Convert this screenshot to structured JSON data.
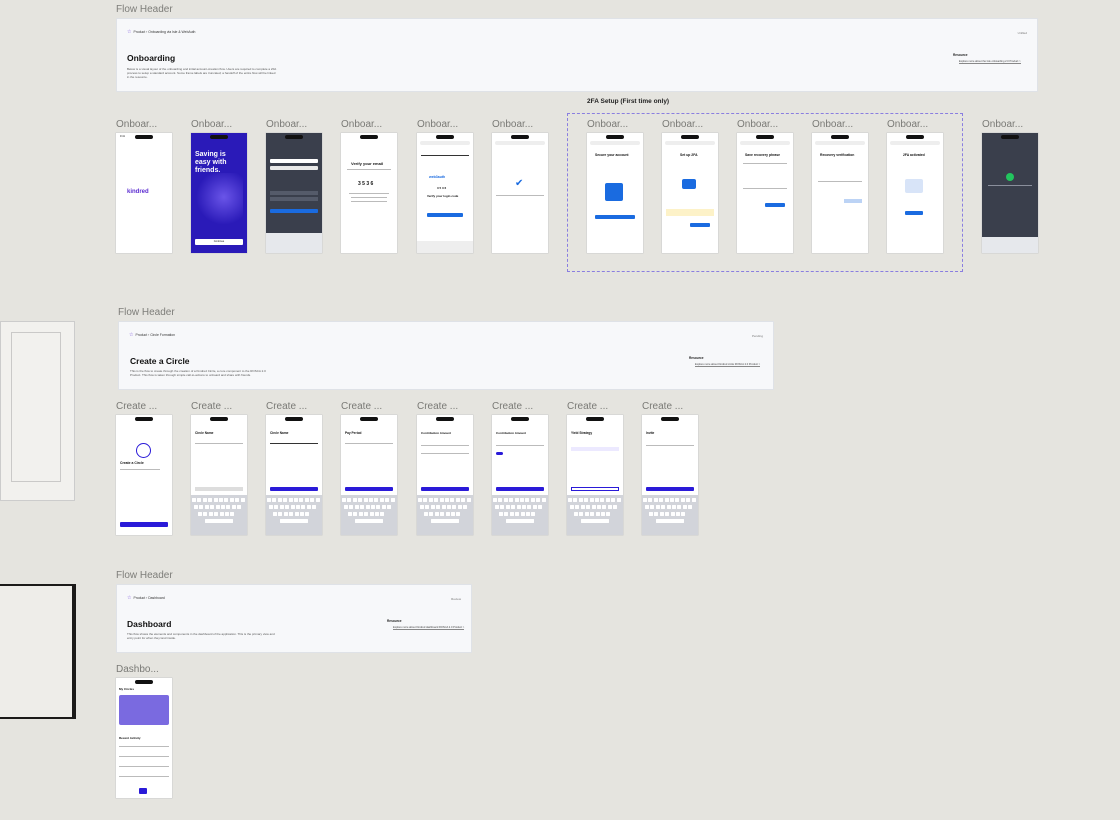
{
  "sections": [
    {
      "id": "onboarding",
      "label": "Flow Header",
      "breadcrumb_root": "Product",
      "breadcrumb_leaf": "Onboarding via Isle & WebAuth",
      "status": "Unfiled",
      "title": "Onboarding",
      "description": "Below is a visual layout of the onboarding and initial account-creation flow. Users are required to complete a 2FA process to setup a standard account. Some frame labels are truncated; a handoff of the entire flow will be linked in the resource.",
      "resource_label": "Resource",
      "resource_value": "Explore more about the Isle onboarding 2.0 Product >",
      "group_title": "2FA Setup (First time only)",
      "frames": [
        "Onboar...",
        "Onboar...",
        "Onboar...",
        "Onboar...",
        "Onboar...",
        "Onboar...",
        "Onboar...",
        "Onboar...",
        "Onboar...",
        "Onboar...",
        "Onboar...",
        "Onboar..."
      ]
    },
    {
      "id": "circle",
      "label": "Flow Header",
      "breadcrumb_root": "Product",
      "breadcrumb_leaf": "Circle Formation",
      "status": "Pending",
      "title": "Create a Circle",
      "description": "This is the flow to create through the creation of a Kindred Circle, a core component to the ROSCA 2.0 Product. This flow is taken through simple call-to-actions to onboard and share with friends.",
      "resource_label": "Resource",
      "resource_value": "Explore more about Kindred circle ROSCA 2.0 Product >",
      "frames": [
        "Create ...",
        "Create ...",
        "Create ...",
        "Create ...",
        "Create ...",
        "Create ...",
        "Create ...",
        "Create ..."
      ]
    },
    {
      "id": "dashboard",
      "label": "Flow Header",
      "breadcrumb_root": "Product",
      "breadcrumb_leaf": "Dashboard",
      "status": "Review",
      "title": "Dashboard",
      "description": "This flow shows the elements and components in the dashboard of the application. This is the primary view and entry point for when they land inside.",
      "resource_label": "Resource",
      "resource_value": "Explore more about Kindred dashboard ROSCA 2.0 Product >",
      "frames": [
        "Dashbo..."
      ]
    }
  ],
  "screens": {
    "kindred_logo": "kindred",
    "saving_title": "Saving is easy with friends.",
    "continue": "Continue",
    "verify_email": "Verify your email",
    "code": "3 5 3 6",
    "webauth": "web3auth",
    "verify_login": "Verify your login code",
    "secure_account": "Secure your account",
    "setup_2fa": "Set up 2FA",
    "save_recovery": "Save recovery phrase",
    "recovery_verification": "Recovery verification",
    "fa_activated": "2FA activated",
    "create_circle": "Create a Circle",
    "circle_name": "Circle Name",
    "pay_period": "Pay Period",
    "contribution_amount": "Contribution Amount",
    "yield_strategy": "Yield Strategy",
    "invite": "Invite",
    "my_circles": "My Circles",
    "recent_activity": "Recent Activity"
  },
  "colors": {
    "background": "#e5e4df",
    "brand_purple": "#2a1ad8",
    "accent_blue": "#1a6be0",
    "dashed": "#8a7ee0"
  }
}
